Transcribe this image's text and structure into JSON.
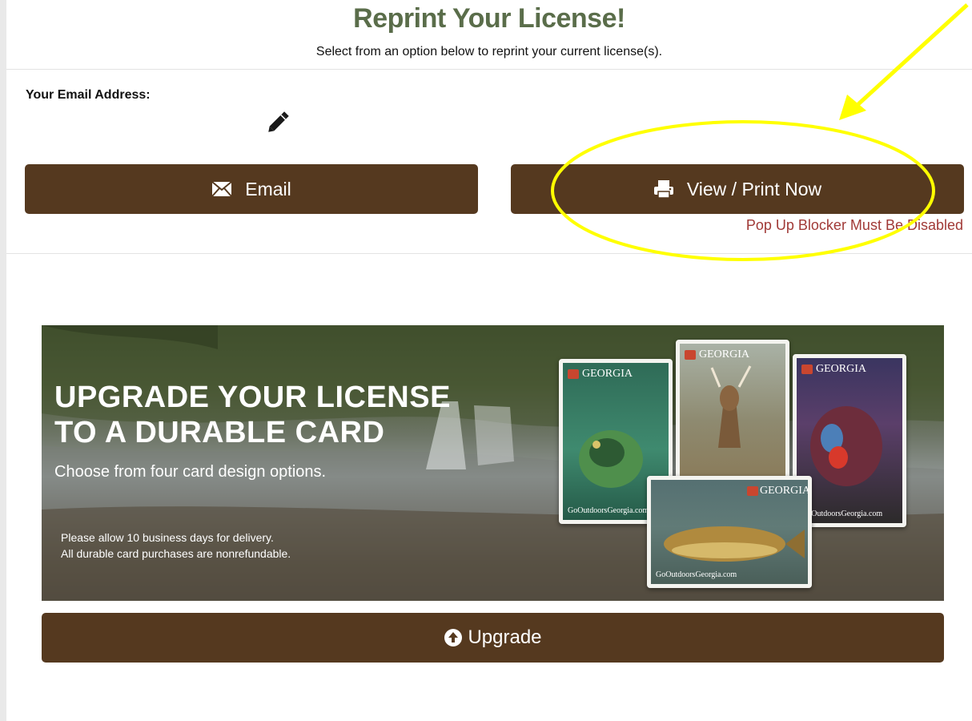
{
  "header": {
    "title": "Reprint Your License!",
    "subtitle": "Select from an option below to reprint your current license(s)."
  },
  "email_section": {
    "label": "Your Email Address:",
    "edit_icon": "pencil-icon"
  },
  "actions": {
    "email_label": "Email",
    "email_icon": "envelope-icon",
    "print_label": "View / Print Now",
    "print_icon": "printer-icon",
    "popup_warning": "Pop Up Blocker Must Be Disabled"
  },
  "banner": {
    "title_line1": "UPGRADE YOUR LICENSE",
    "title_line2": "TO A DURABLE CARD",
    "subtitle": "Choose from four card design options.",
    "note1": "Please allow 10 business days for delivery.",
    "note2": "All durable card purchases are nonrefundable.",
    "cards": [
      {
        "design": "bass",
        "brand": "GEORGIA",
        "website": "GoOutdoorsGeorgia.com"
      },
      {
        "design": "deer",
        "brand": "GEORGIA",
        "website": ""
      },
      {
        "design": "turkey",
        "brand": "GEORGIA",
        "website": "GoOutdoorsGeorgia.com"
      },
      {
        "design": "trout",
        "brand": "GEORGIA",
        "website": "GoOutdoorsGeorgia.com"
      }
    ]
  },
  "upgrade": {
    "label": "Upgrade",
    "icon": "arrow-up-circle-icon"
  },
  "colors": {
    "title_green": "#5a6d4a",
    "button_brown": "#55391f",
    "warning_red": "#a13a37",
    "annotation_yellow": "#ffff00"
  }
}
